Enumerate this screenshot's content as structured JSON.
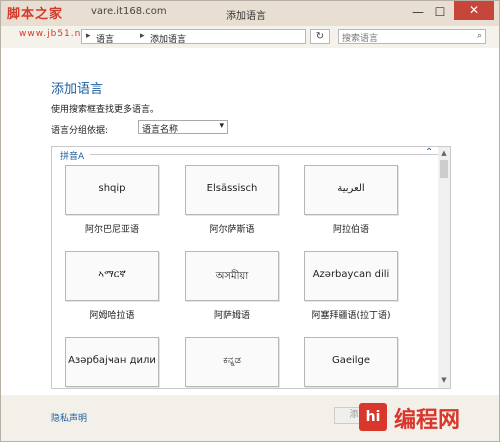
{
  "window": {
    "title": "添加语言",
    "watermark_logo": "脚本之家",
    "watermark_domain": "vare.it168.com",
    "watermark_sub": "www.jb51.net",
    "minimize_glyph": "—",
    "maximize_glyph": "☐",
    "close_glyph": "✕"
  },
  "address_bar": {
    "crumbs": [
      "语言",
      "添加语言"
    ],
    "separator": "▸",
    "refresh_glyph": "↻",
    "search_placeholder": "搜索语言",
    "search_icon": "search-icon"
  },
  "content": {
    "title": "添加语言",
    "description": "使用搜索框查找更多语言。",
    "group_label": "语言分组依据:",
    "group_selected": "语言名称",
    "section_header": "拼音A",
    "tiles": [
      {
        "native": "shqip",
        "caption": "阿尔巴尼亚语"
      },
      {
        "native": "Elsässisch",
        "caption": "阿尔萨斯语"
      },
      {
        "native": "العربية",
        "caption": "阿拉伯语"
      },
      {
        "native": "ኣማርኛ",
        "caption": "阿姆哈拉语"
      },
      {
        "native": "অসমীয়া",
        "caption": "阿萨姆语"
      },
      {
        "native": "Azərbaycan dili",
        "caption": "阿塞拜疆语(拉丁语)"
      },
      {
        "native": "Азәрбајҹан дили",
        "caption": ""
      },
      {
        "native": "ಕನ್ನಡ",
        "caption": ""
      },
      {
        "native": "Gaeilge",
        "caption": ""
      }
    ]
  },
  "footer": {
    "privacy_link": "隐私声明",
    "add_button": "添",
    "brand_logo": "hi",
    "brand_name": "编程网"
  },
  "colors": {
    "accent": "#1f5fa0",
    "brand": "#d9362c",
    "titlebar": "#e8dfd2"
  }
}
